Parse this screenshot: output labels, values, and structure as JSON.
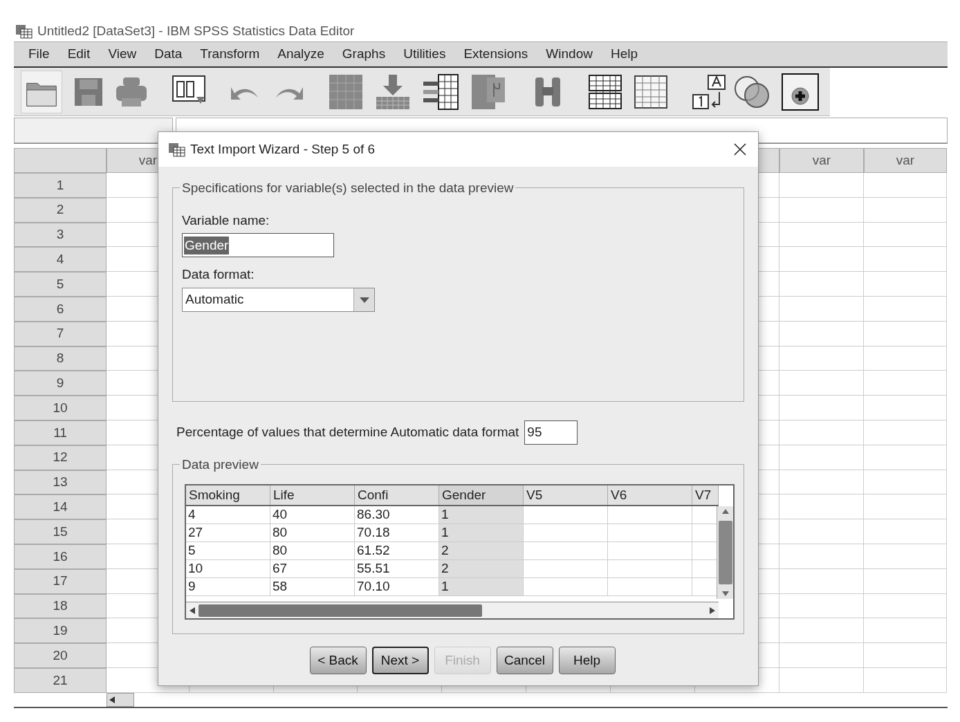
{
  "window": {
    "title": "Untitled2 [DataSet3] - IBM SPSS Statistics Data Editor"
  },
  "menu": [
    {
      "label": "File"
    },
    {
      "label": "Edit"
    },
    {
      "label": "View"
    },
    {
      "label": "Data"
    },
    {
      "label": "Transform"
    },
    {
      "label": "Analyze"
    },
    {
      "label": "Graphs"
    },
    {
      "label": "Utilities"
    },
    {
      "label": "Extensions"
    },
    {
      "label": "Window"
    },
    {
      "label": "Help"
    }
  ],
  "grid": {
    "column_headers": [
      "var",
      "var",
      "var"
    ],
    "row_numbers": [
      "1",
      "2",
      "3",
      "4",
      "5",
      "6",
      "7",
      "8",
      "9",
      "10",
      "11",
      "12",
      "13",
      "14",
      "15",
      "16",
      "17",
      "18",
      "19",
      "20",
      "21"
    ]
  },
  "dialog": {
    "title": "Text Import Wizard - Step 5 of 6",
    "spec_group": {
      "title": "Specifications for variable(s) selected in the data preview",
      "variable_name": {
        "label": "Variable name:",
        "value": "Gender",
        "value_selected": true
      },
      "data_format": {
        "label": "Data format:",
        "value": "Automatic"
      }
    },
    "percentage": {
      "label": "Percentage of values that determine Automatic data format",
      "value": "95"
    },
    "preview": {
      "title": "Data preview",
      "columns": [
        {
          "name": "Smoking",
          "selected": false
        },
        {
          "name": "Life",
          "selected": false
        },
        {
          "name": "Confi",
          "selected": false
        },
        {
          "name": "Gender",
          "selected": true
        },
        {
          "name": "V5",
          "selected": false
        },
        {
          "name": "V6",
          "selected": false
        },
        {
          "name": "V7",
          "selected": false
        }
      ],
      "rows": [
        [
          "4",
          "40",
          "86.30",
          "1"
        ],
        [
          "27",
          "80",
          "70.18",
          "1"
        ],
        [
          "5",
          "80",
          "61.52",
          "2"
        ],
        [
          "10",
          "67",
          "55.51",
          "2"
        ],
        [
          "9",
          "58",
          "70.10",
          "1"
        ]
      ]
    },
    "buttons": [
      {
        "label": "< Back",
        "disabled": false,
        "default": false
      },
      {
        "label": "Next >",
        "disabled": false,
        "default": true
      },
      {
        "label": "Finish",
        "disabled": true,
        "default": false
      },
      {
        "label": "Cancel",
        "disabled": false,
        "default": false
      },
      {
        "label": "Help",
        "disabled": false,
        "default": false
      }
    ]
  }
}
